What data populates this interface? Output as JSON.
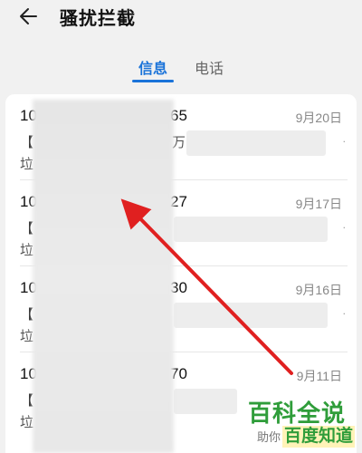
{
  "header": {
    "title": "骚扰拦截",
    "back_icon": "arrow-left-icon"
  },
  "tabs": [
    {
      "label": "信息",
      "active": true
    },
    {
      "label": "电话",
      "active": false
    }
  ],
  "messages": [
    {
      "sender_start": "10",
      "sender_end": "65",
      "date": "9月20日",
      "preview_open": "【",
      "preview_visible": "万",
      "category_visible": "垃"
    },
    {
      "sender_start": "10",
      "sender_end": "27",
      "date": "9月17日",
      "preview_open": "【",
      "preview_visible": "",
      "category_visible": "垃"
    },
    {
      "sender_start": "10",
      "sender_end": "30",
      "date": "9月16日",
      "preview_open": "【",
      "preview_visible": "",
      "category_visible": "垃"
    },
    {
      "sender_start": "10",
      "sender_end": "70",
      "date": "9月11日",
      "preview_open": "【",
      "preview_visible": "",
      "category_visible": "垃"
    }
  ],
  "watermark": {
    "main": "百科全说",
    "help": "助你",
    "sub": "百度知道"
  },
  "colors": {
    "accent": "#1a73d9",
    "arrow": "#e02020",
    "watermark_green": "#2f9d3a"
  }
}
